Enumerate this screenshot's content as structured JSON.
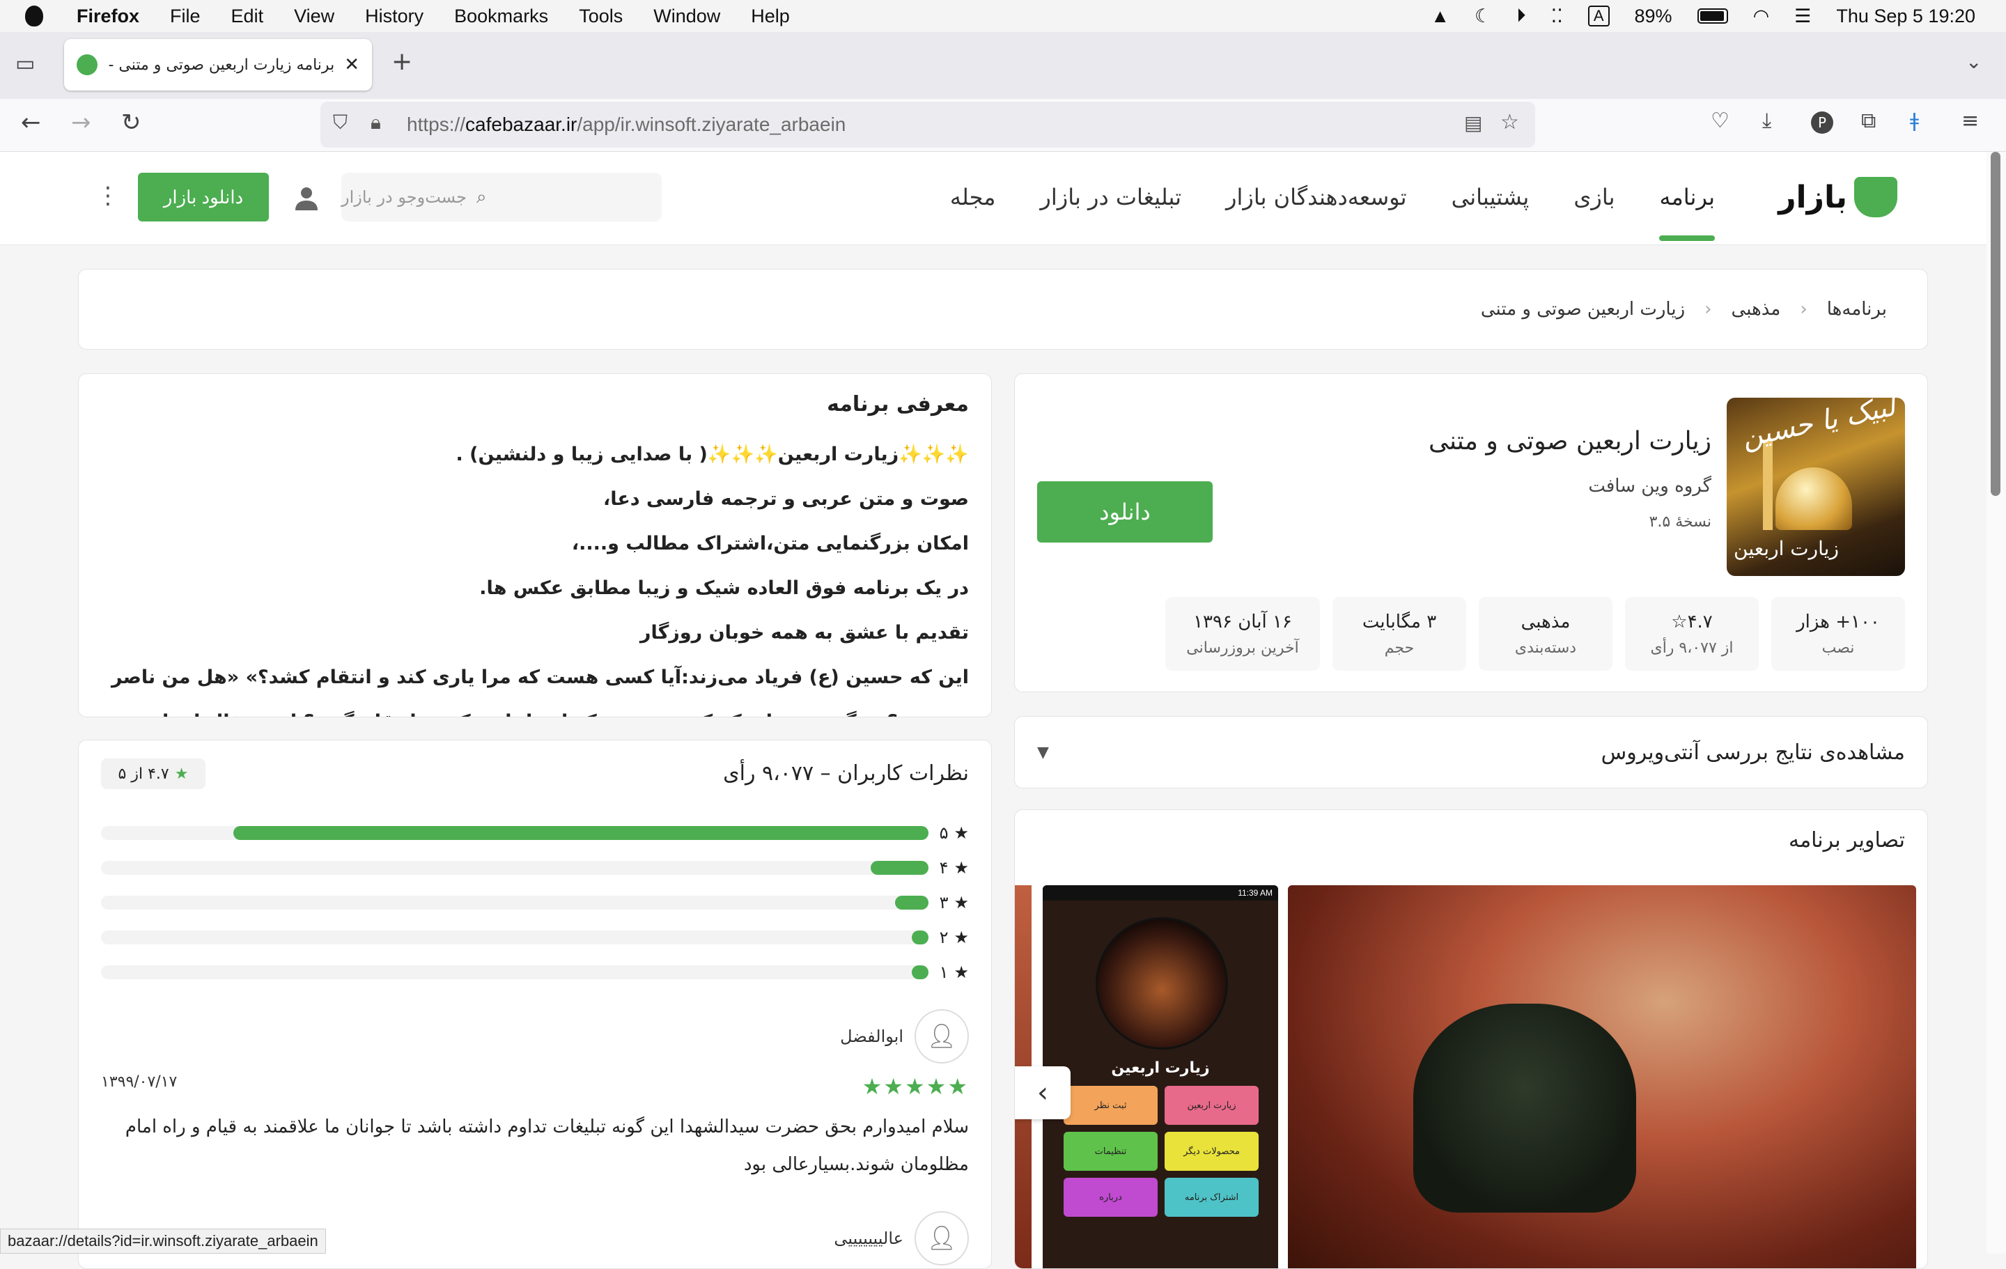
{
  "menubar": {
    "app": "Firefox",
    "items": [
      "File",
      "Edit",
      "View",
      "History",
      "Bookmarks",
      "Tools",
      "Window",
      "Help"
    ],
    "battery": "89%",
    "input_indicator": "A",
    "datetime": "Thu Sep 5  19:20"
  },
  "browser": {
    "tab_title": "برنامه زیارت اربعین صوتی و متنی - دانلود",
    "url_prefix": "https://",
    "url_domain": "cafebazaar.ir",
    "url_path": "/app/ir.winsoft.ziyarate_arbaein",
    "status_url": "bazaar://details?id=ir.winsoft.ziyarate_arbaein"
  },
  "site": {
    "logo": "بازار",
    "nav": [
      "برنامه",
      "بازی",
      "پشتیبانی",
      "توسعه‌دهندگان بازار",
      "تبلیغات در بازار",
      "مجله"
    ],
    "search_placeholder": "جست‌وجو در بازار",
    "download_bazaar": "دانلود بازار"
  },
  "breadcrumb": [
    "برنامه‌ها",
    "مذهبی",
    "زیارت اربعین صوتی و متنی"
  ],
  "app": {
    "title": "زیارت اربعین صوتی و متنی",
    "developer": "گروه وین سافت",
    "version": "نسخهٔ ۳.۵",
    "download": "دانلود",
    "icon_text_top": "لبیک یا حسین",
    "icon_text_bottom": "زیارت اربعین",
    "stats": [
      {
        "value": "۱۰۰+ هزار",
        "label": "نصب"
      },
      {
        "value": "۴.۷☆",
        "label": "از ۹،۰۷۷ رأی"
      },
      {
        "value": "مذهبی",
        "label": "دسته‌بندی"
      },
      {
        "value": "۳ مگابایت",
        "label": "حجم"
      },
      {
        "value": "۱۶ آبان ۱۳۹۶",
        "label": "آخرین بروزرسانی"
      }
    ]
  },
  "antivirus": "مشاهده‌ی نتایج بررسی آنتی‌ویروس",
  "screenshots": {
    "title": "تصاویر برنامه",
    "phone_time": "11:39 AM",
    "phone_title": "زیارت اربعین",
    "phone_buttons": [
      "زیارت اربعین",
      "ثبت نظر",
      "محصولات دیگر",
      "تنظیمات",
      "اشتراک برنامه",
      "درباره"
    ]
  },
  "description": {
    "title": "معرفی برنامه",
    "lines": [
      "✨✨✨زیارت اربعین✨✨✨( با صدایی زیبا و دلنشین) .",
      "صوت و متن عربی و ترجمه فارسی دعا،",
      "امکان بزرگنمایی متن،اشتراک مطالب و....،",
      "در یک برنامه فوق العاده شیک و زیبا مطابق عکس ها.",
      "تقدیم با عشق به همه خوبان روزگار",
      "این که حسین (ع) فریاد می‌زند:آیا کسی هست که مرا یاری کند و انتقام کشد؟» «هل من ناصر ینصرنی؟» مگر نمی داند که کسی نیست که او را یاری کند و انتقام گیرد؟ این سؤال از تاریخ"
    ]
  },
  "reviews": {
    "title": "نظرات کاربران – ۹،۰۷۷ رأی",
    "rating_badge": "۴.۷ از ۵",
    "bars": [
      {
        "label": "۵",
        "fraction": 0.84
      },
      {
        "label": "۴",
        "fraction": 0.07
      },
      {
        "label": "۳",
        "fraction": 0.04
      },
      {
        "label": "۲",
        "fraction": 0.02
      },
      {
        "label": "۱",
        "fraction": 0.02
      }
    ],
    "items": [
      {
        "user": "ابوالفضل",
        "date": "۱۳۹۹/۰۷/۱۷",
        "stars": "★★★★★",
        "text": "سلام امیدوارم بحق حضرت سیدالشهدا این گونه تبلیغات تداوم داشته باشد تا جوانان ما علاقمند به قیام و راه امام مظلومان شوند.بسیارعالی بود"
      },
      {
        "user": "عالیییییییی"
      }
    ]
  },
  "colors": {
    "accent": "#4cae50"
  }
}
